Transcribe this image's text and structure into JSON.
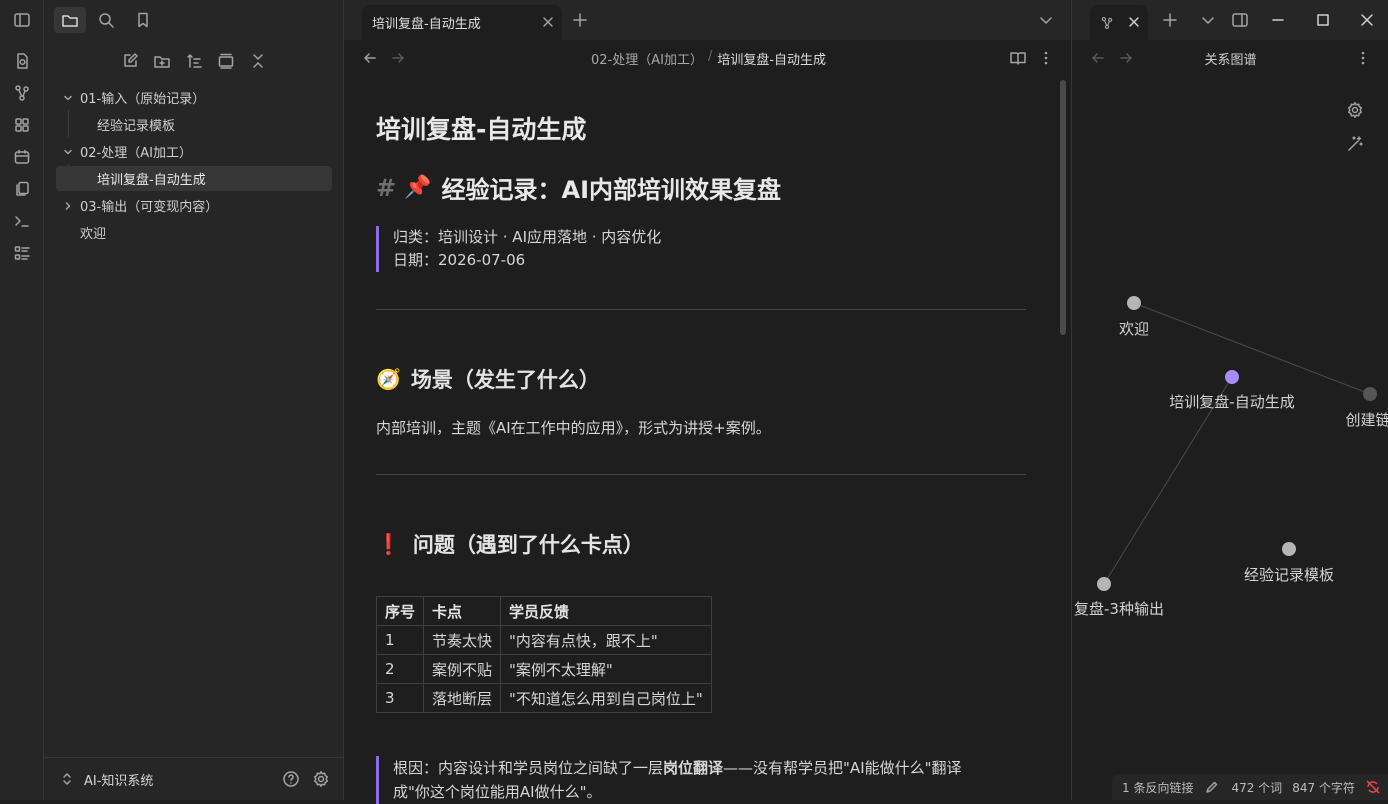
{
  "ribbon": {
    "icons": [
      "sidebar-toggle-icon",
      "new-note-icon",
      "graph-icon",
      "canvas-icon",
      "calendar-icon",
      "templates-icon",
      "terminal-icon",
      "outline-icon"
    ]
  },
  "sidebar": {
    "vault_name": "AI-知识系统",
    "tree": [
      {
        "label": "01-输入（原始记录）",
        "type": "folder"
      },
      {
        "label": "经验记录模板",
        "type": "file"
      },
      {
        "label": "02-处理（AI加工）",
        "type": "folder"
      },
      {
        "label": "培训复盘-自动生成",
        "type": "file",
        "active": true
      },
      {
        "label": "03-输出（可变现内容）",
        "type": "folder"
      },
      {
        "label": "欢迎",
        "type": "file"
      }
    ]
  },
  "tabs": {
    "active": "培训复盘-自动生成"
  },
  "breadcrumb": {
    "folder": "02-处理（AI加工）",
    "sep": "/",
    "file": "培训复盘-自动生成"
  },
  "note": {
    "inline_title": "培训复盘-自动生成",
    "h1_hash": "#",
    "h1_emoji": "📌",
    "h1": "经验记录：AI内部培训效果复盘",
    "meta_category": "归类：培训设计 · AI应用落地 · 内容优化",
    "meta_date": "日期：2026-07-06",
    "section1_emoji": "🧭",
    "section1_title": "场景（发生了什么）",
    "section1_text": "内部培训，主题《AI在工作中的应用》，形式为讲授+案例。",
    "section2_emoji": "❗",
    "section2_title": "问题（遇到了什么卡点）",
    "table": {
      "headers": [
        "序号",
        "卡点",
        "学员反馈"
      ],
      "rows": [
        [
          "1",
          "节奏太快",
          "\"内容有点快，跟不上\""
        ],
        [
          "2",
          "案例不贴",
          "\"案例不太理解\""
        ],
        [
          "3",
          "落地断层",
          "\"不知道怎么用到自己岗位上\""
        ]
      ]
    },
    "root_cause_prefix": "根因：内容设计和学员岗位之间缺了一层",
    "root_cause_bold": "岗位翻译",
    "root_cause_suffix": "——没有帮学员把\"AI能做什么\"翻译",
    "root_cause_line2": "成\"你这个岗位能用AI做什么\"。"
  },
  "graph_pane": {
    "title": "关系图谱",
    "nodes": [
      {
        "label": "欢迎",
        "color": "#b5b5b5"
      },
      {
        "label": "培训复盘-自动生成",
        "color": "#a88bfa"
      },
      {
        "label": "创建链",
        "color": "#555555"
      },
      {
        "label": "经验记录模板",
        "color": "#b5b5b5"
      },
      {
        "label": "复盘-3种输出",
        "color": "#b5b5b5"
      }
    ]
  },
  "status": {
    "backlinks": "1 条反向链接",
    "words": "472 个词",
    "chars": "847 个字符"
  }
}
